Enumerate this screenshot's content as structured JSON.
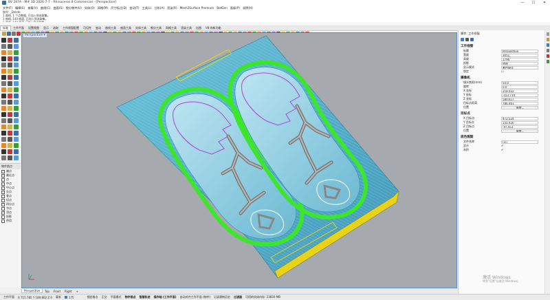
{
  "app": {
    "title": "BV 267A - M# 3D 2026-7-7 - Rhinoceros 8 Commercial - [Perspective]",
    "window_buttons": [
      "—",
      "☐",
      "✕"
    ]
  },
  "menu": [
    "文件(F)",
    "编辑(E)",
    "查看(V)",
    "曲线(C)",
    "曲面(S)",
    "细分物件(U)",
    "实体(O)",
    "网格(M)",
    "尺寸标注(D)",
    "变动(T)",
    "工具(L)",
    "分析(A)",
    "渲染(R)",
    "Mesh2Surface Premium",
    "BotGen",
    "面板(P)",
    "说明(H)"
  ],
  "command_history": [
    "指令: _Delete",
    "1 曲线, 1 个点数据, 已加入到选取集。",
    "1 曲线, 140 曲面, 已加入到选取集。",
    "1 曲线, 140 曲面 已加入到选取集。"
  ],
  "tabs": [
    "标准",
    "工作平面",
    "设置视图",
    "显示",
    "选取",
    "工作视窗配置",
    "可见性",
    "变动",
    "曲线工具",
    "曲面工具",
    "实体工具",
    "细分工具",
    "网格工具",
    "渲染工具",
    "出图",
    "V8 的新功能"
  ],
  "active_tab": "标准",
  "viewport": {
    "label": "Perspective ▾",
    "tabs": [
      "Perspective",
      "Top",
      "Front",
      "Right",
      "+"
    ],
    "active_tab": "Perspective"
  },
  "osnap": {
    "header": "物件锁点",
    "items": [
      {
        "label": "端点",
        "checked": true
      },
      {
        "label": "最近点",
        "checked": true
      },
      {
        "label": "点",
        "checked": false
      },
      {
        "label": "中点",
        "checked": true
      },
      {
        "label": "中心点",
        "checked": true
      },
      {
        "label": "交点",
        "checked": true
      },
      {
        "label": "垂点",
        "checked": false
      },
      {
        "label": "切点",
        "checked": false
      },
      {
        "label": "四分点",
        "checked": true
      },
      {
        "label": "节点",
        "checked": false
      },
      {
        "label": "顶点",
        "checked": true
      },
      {
        "label": "投影",
        "checked": false
      },
      {
        "label": "停用",
        "checked": false
      }
    ]
  },
  "panel": {
    "title": "属性: 工作视窗",
    "sections": [
      {
        "name": "工作视窗",
        "rows": [
          {
            "k": "标题",
            "v": "Perspective"
          },
          {
            "k": "宽度",
            "v": "3051"
          },
          {
            "k": "高度",
            "v": "1796"
          },
          {
            "k": "投影",
            "v": "透视"
          },
          {
            "k": "显示模式",
            "v": "着色模式"
          },
          {
            "k": "锁定",
            "v": "",
            "check": "☐"
          }
        ]
      },
      {
        "name": "摄像机",
        "rows": [
          {
            "k": "镜头焦距(mm)",
            "v": "50.0"
          },
          {
            "k": "旋转",
            "v": "0.0"
          },
          {
            "k": "X 坐标",
            "v": "218.422"
          },
          {
            "k": "Y 坐标",
            "v": "-223.714"
          },
          {
            "k": "Z 坐标",
            "v": "580.617"
          },
          {
            "k": "目标点距离",
            "v": "786.461"
          },
          {
            "k": "位置",
            "v": "放置...",
            "btn": true
          }
        ]
      },
      {
        "name": "目标点",
        "rows": [
          {
            "k": "X 目标点",
            "v": "472.524"
          },
          {
            "k": "Y 目标点",
            "v": "155.420"
          },
          {
            "k": "Z 目标点",
            "v": "-97.451"
          },
          {
            "k": "位置",
            "v": "放置...",
            "btn": true
          }
        ]
      },
      {
        "name": "底色图案",
        "rows": [
          {
            "k": "文件名称",
            "v": "(无)"
          },
          {
            "k": "显示",
            "v": "",
            "check": "✔"
          },
          {
            "k": "灰阶",
            "v": "",
            "check": "✔"
          }
        ]
      }
    ]
  },
  "status": {
    "cplane": "工作平面",
    "coords": "X 715.785 Y 189.802 Z 0",
    "unit": "毫米",
    "layer": "175",
    "toggles": [
      "锁定格点",
      "正交",
      "平面模式",
      "物件锁点",
      "智慧轨迹",
      "操作轴 (工作平面)",
      "自动对齐工作平面 (物件)",
      "记录建构历史",
      "过滤器",
      "可用的实体内存: 23830 MB"
    ],
    "bold_toggles": [
      "物件锁点",
      "智慧轨迹",
      "操作轴 (工作平面)",
      "过滤器"
    ]
  },
  "watermark": {
    "line1": "激活 Windows",
    "line2": "转到\"设置\"以激活 Windows。"
  },
  "colors": {
    "viewport_bg": "#a6a9ad",
    "mold_surface": "#5ab4cf",
    "insole_green": "#3ce62a",
    "highlight_yellow": "#e8d21a",
    "selection_purple": "#b040e0"
  }
}
